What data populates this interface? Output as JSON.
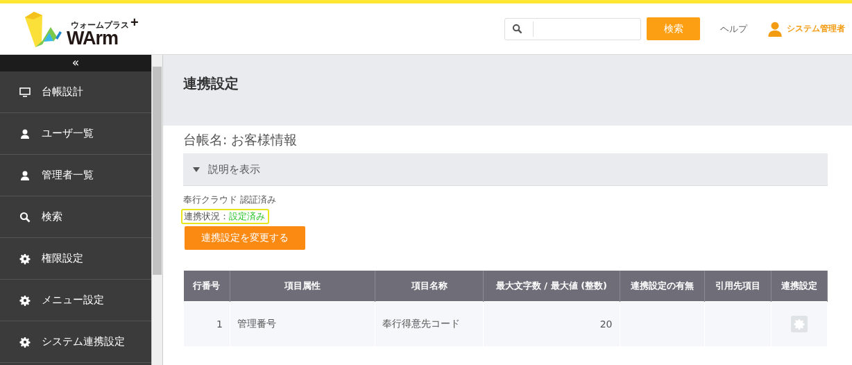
{
  "logo": {
    "kana": "ウォームプラス",
    "name": "WArm",
    "plus": "+"
  },
  "header": {
    "search_button": "検索",
    "help": "ヘルプ",
    "user": "システム管理者"
  },
  "sidebar": {
    "collapse": "«",
    "items": [
      {
        "label": "台帳設計",
        "kind": "monitor"
      },
      {
        "label": "ユーザ一覧",
        "kind": "user"
      },
      {
        "label": "管理者一覧",
        "kind": "user"
      },
      {
        "label": "検索",
        "kind": "search"
      },
      {
        "label": "権限設定",
        "kind": "gear"
      },
      {
        "label": "メニュー設定",
        "kind": "gear"
      },
      {
        "label": "システム連携設定",
        "kind": "gear"
      }
    ]
  },
  "page": {
    "title": "連携設定",
    "ledger": "台帳名: お客様情報",
    "toggle": "説明を表示",
    "auth": "奉行クラウド 認証済み",
    "status_label": "連携状況：",
    "status_value": "設定済み",
    "change_button": "連携設定を変更する"
  },
  "table": {
    "columns": [
      "行番号",
      "項目属性",
      "項目名称",
      "最大文字数 / 最大値 (整数)",
      "連携設定の有無",
      "引用先項目",
      "連携設定"
    ],
    "rows": [
      {
        "no": "1",
        "attribute": "管理番号",
        "name": "奉行得意先コード",
        "max": "20"
      }
    ]
  }
}
